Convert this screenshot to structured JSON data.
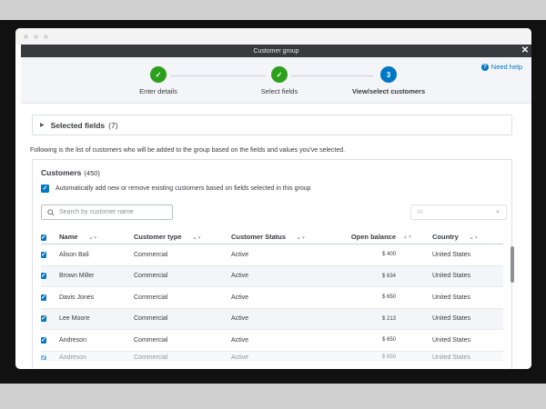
{
  "window": {
    "title": "Customer group",
    "close_label": "✕"
  },
  "stepper": {
    "steps": [
      {
        "label": "Enter details",
        "state": "done"
      },
      {
        "label": "Select fields",
        "state": "done"
      },
      {
        "label": "View/select customers",
        "state": "active",
        "number": "3"
      }
    ],
    "help_label": "Need help"
  },
  "selected_fields": {
    "title": "Selected fields",
    "count": "(7)"
  },
  "info_text": "Following is the list of customers who will be added to the group based on the fields and values you've selected.",
  "customers": {
    "title": "Customers",
    "count": "(450)",
    "auto_checkbox_label": "Automatically add new or remove existing customers based on fields selected in this group",
    "auto_checked": true,
    "search_placeholder": "Search by customer name",
    "filter_value": "All"
  },
  "table": {
    "columns": [
      "Name",
      "Customer type",
      "Customer Status",
      "Open balance",
      "Country"
    ],
    "rows": [
      {
        "name": "Alison Bali",
        "type": "Commercial",
        "status": "Active",
        "balance": "$ 400",
        "country": "United States",
        "checked": true
      },
      {
        "name": "Brown Miller",
        "type": "Commercial",
        "status": "Active",
        "balance": "$ 634",
        "country": "United States",
        "checked": true
      },
      {
        "name": "Davis Jones",
        "type": "Commercial",
        "status": "Active",
        "balance": "$ 650",
        "country": "United States",
        "checked": true
      },
      {
        "name": "Lee Moore",
        "type": "Commercial",
        "status": "Active",
        "balance": "$ 213",
        "country": "United States",
        "checked": true
      },
      {
        "name": "Andreson",
        "type": "Commercial",
        "status": "Active",
        "balance": "$ 650",
        "country": "United States",
        "checked": true
      },
      {
        "name": "Andreson",
        "type": "Commercial",
        "status": "Active",
        "balance": "$ 650",
        "country": "United States",
        "checked": true
      }
    ]
  },
  "colors": {
    "accent": "#0077c5",
    "success": "#2ca01c",
    "titlebar": "#393a3d"
  },
  "icons": {
    "search": "search-icon",
    "close": "close-icon",
    "help": "help-icon",
    "check": "check-icon",
    "caret": "caret-right-icon",
    "dropdown": "chevron-down-icon"
  }
}
